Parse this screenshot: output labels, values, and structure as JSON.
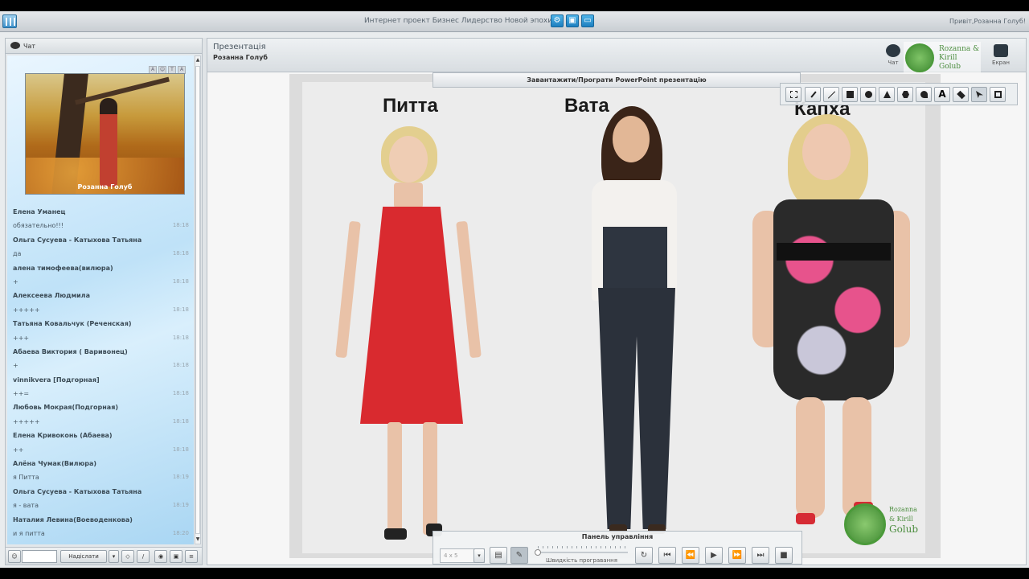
{
  "topbar": {
    "title": "Интернет проект Бизнес Лидерство Новой эпохи",
    "greeting": "Привіт,Розанна Голуб!"
  },
  "chat": {
    "title": "Чат",
    "video_caption": "Розанна Голуб",
    "messages": [
      {
        "name": "Елена Уманец",
        "text": "обязательно!!!",
        "time": "18:18"
      },
      {
        "name": "Ольга Сусуева - Катыхова Татьяна",
        "text": "да",
        "time": "18:18"
      },
      {
        "name": "алена тимофеева(вилюра)",
        "text": "+",
        "time": "18:18"
      },
      {
        "name": "Алексеева Людмила",
        "text": "+++++",
        "time": "18:18"
      },
      {
        "name": "Татьяна Ковальчук (Реченская)",
        "text": "+++",
        "time": "18:18"
      },
      {
        "name": "Абаева Виктория ( Варивонец)",
        "text": "+",
        "time": "18:18"
      },
      {
        "name": "vinnikvera [Подгорная]",
        "text": "++=",
        "time": "18:18"
      },
      {
        "name": "Любовь Мокрая(Подгорная)",
        "text": "+++++",
        "time": "18:18"
      },
      {
        "name": "Елена Кривоконь (Абаева)",
        "text": "++",
        "time": "18:18"
      },
      {
        "name": "Алёна Чумак(Вилюра)",
        "text": "я Питта",
        "time": "18:19"
      },
      {
        "name": "Ольга Сусуева - Катыхова Татьяна",
        "text": "я - вата",
        "time": "18:19"
      },
      {
        "name": "Наталия Левина(Воеводенкова)",
        "text": "и я питта",
        "time": "18:20"
      }
    ],
    "send_label": "Надіслати"
  },
  "presentation": {
    "title": "Презентація",
    "presenter": "Розанна Голуб",
    "chat_icon_label": "Чат",
    "screen_icon_label": "Екран",
    "brand_line1": "Rozanna & Kirill",
    "brand_line2": "Golub",
    "upload_label": "Завантажити/Програти PowerPoint презентацію",
    "slide": {
      "labels": [
        "Питта",
        "Вата",
        "Капха"
      ]
    },
    "control_panel": {
      "title": "Панель управління",
      "grid_value": "4 x 5",
      "speed_label": "Швидкість програвання"
    }
  },
  "colors": {
    "accent": "#1d7fbf",
    "pitta_dress": "#d92a2f",
    "kapha_dress": "#e7538c"
  }
}
